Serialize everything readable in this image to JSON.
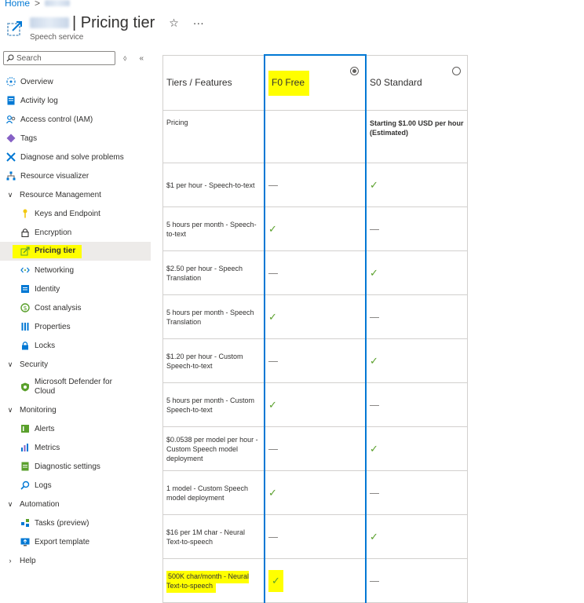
{
  "breadcrumb": {
    "home": "Home",
    "sep": ">"
  },
  "header": {
    "title": "| Pricing tier",
    "subtitle": "Speech service",
    "star": "☆",
    "more": "···"
  },
  "search": {
    "placeholder": "Search",
    "sort": "⬨",
    "collapse": "«"
  },
  "nav": {
    "overview": "Overview",
    "activity_log": "Activity log",
    "access_control": "Access control (IAM)",
    "tags": "Tags",
    "diagnose": "Diagnose and solve problems",
    "resource_visualizer": "Resource visualizer",
    "resource_management": "Resource Management",
    "keys": "Keys and Endpoint",
    "encryption": "Encryption",
    "pricing_tier": "Pricing tier",
    "networking": "Networking",
    "identity": "Identity",
    "cost_analysis": "Cost analysis",
    "properties": "Properties",
    "locks": "Locks",
    "security": "Security",
    "defender_l1": "Microsoft Defender for",
    "defender_l2": "Cloud",
    "monitoring": "Monitoring",
    "alerts": "Alerts",
    "metrics": "Metrics",
    "diagnostic_settings": "Diagnostic settings",
    "logs": "Logs",
    "automation": "Automation",
    "tasks": "Tasks (preview)",
    "export_template": "Export template",
    "help": "Help"
  },
  "table": {
    "header_features": "Tiers / Features",
    "tier_f0": "F0 Free",
    "tier_s0": "S0 Standard",
    "pricing_label": "Pricing",
    "s0_price_l1": "Starting $1.00 USD per hour",
    "s0_price_l2": "(Estimated)",
    "rows": [
      {
        "l1": "$1 per hour - Speech-to-text",
        "l2": "",
        "f0": false,
        "s0": true
      },
      {
        "l1": "5 hours per month - Speech-",
        "l2": "to-text",
        "f0": true,
        "s0": false
      },
      {
        "l1": "$2.50 per hour - Speech",
        "l2": "Translation",
        "f0": false,
        "s0": true
      },
      {
        "l1": "5 hours per month - Speech",
        "l2": "Translation",
        "f0": true,
        "s0": false
      },
      {
        "l1": "$1.20 per hour - Custom",
        "l2": "Speech-to-text",
        "f0": false,
        "s0": true
      },
      {
        "l1": "5 hours per month - Custom",
        "l2": "Speech-to-text",
        "f0": true,
        "s0": false
      },
      {
        "l1": "$0.0538 per model per hour -",
        "l2": "Custom Speech model",
        "l3": "deployment",
        "f0": false,
        "s0": true
      },
      {
        "l1": "1 model - Custom Speech",
        "l2": "model deployment",
        "f0": true,
        "s0": false
      },
      {
        "l1": "$16 per 1M char - Neural",
        "l2": "Text-to-speech",
        "f0": false,
        "s0": true
      },
      {
        "l1": "500K char/month - Neural",
        "l2": "Text-to-speech",
        "f0": true,
        "s0": false
      }
    ],
    "check": "✓"
  }
}
